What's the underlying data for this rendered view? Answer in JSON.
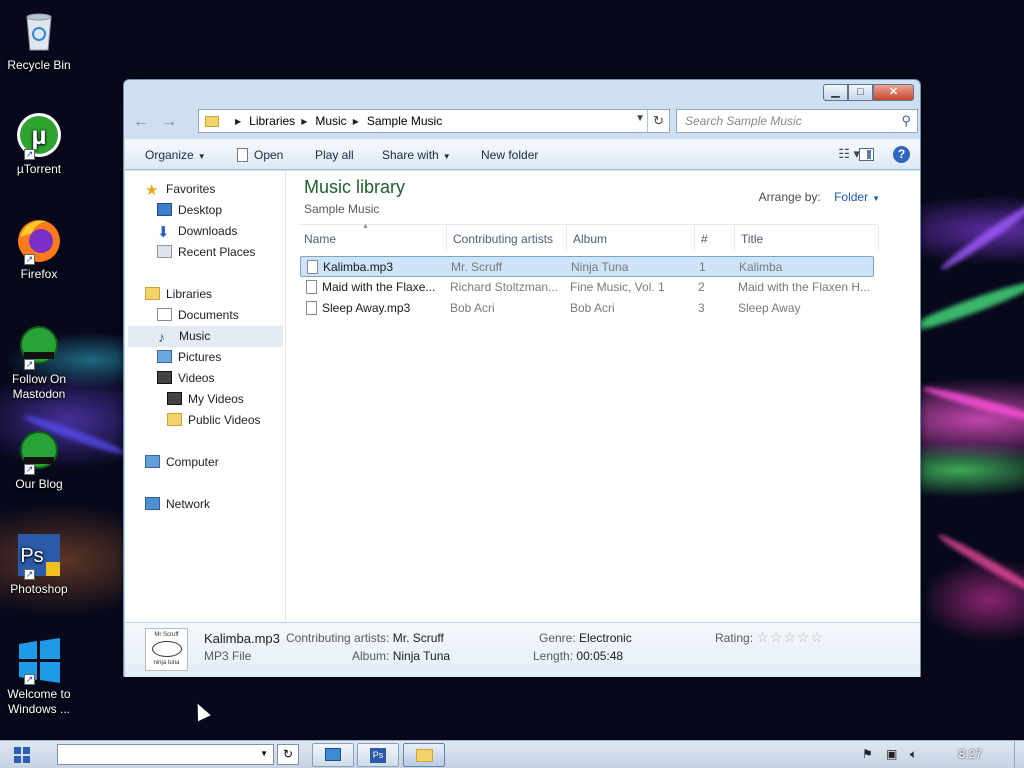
{
  "desktop": {
    "icons": [
      {
        "label": "Recycle Bin",
        "icon": "recycle-bin-icon"
      },
      {
        "label": "µTorrent",
        "icon": "utorrent-icon"
      },
      {
        "label": "Firefox",
        "icon": "firefox-icon"
      },
      {
        "label": "Follow On Mastodon",
        "icon": "mastodon-shortcut-icon"
      },
      {
        "label": "Our Blog",
        "icon": "blog-shortcut-icon"
      },
      {
        "label": "Photoshop",
        "icon": "photoshop-icon"
      },
      {
        "label": "Welcome to Windows ...",
        "icon": "windows-logo-icon"
      }
    ]
  },
  "window": {
    "address": {
      "crumbs": [
        "Libraries",
        "Music",
        "Sample Music"
      ]
    },
    "search": {
      "placeholder": "Search Sample Music"
    },
    "toolbar": {
      "organize": "Organize",
      "open": "Open",
      "play_all": "Play all",
      "share_with": "Share with",
      "new_folder": "New folder"
    },
    "nav": {
      "favorites": "Favorites",
      "desktop": "Desktop",
      "downloads": "Downloads",
      "recent_places": "Recent Places",
      "libraries": "Libraries",
      "documents": "Documents",
      "music": "Music",
      "pictures": "Pictures",
      "videos": "Videos",
      "my_videos": "My Videos",
      "public_videos": "Public Videos",
      "computer": "Computer",
      "network": "Network"
    },
    "library": {
      "title": "Music library",
      "subtitle": "Sample Music",
      "arrange_label": "Arrange by:",
      "arrange_value": "Folder"
    },
    "columns": {
      "name": "Name",
      "artists": "Contributing artists",
      "album": "Album",
      "number": "#",
      "title": "Title"
    },
    "files": [
      {
        "name": "Kalimba.mp3",
        "artist": "Mr. Scruff",
        "album": "Ninja Tuna",
        "number": "1",
        "title": "Kalimba"
      },
      {
        "name": "Maid with the Flaxe...",
        "artist": "Richard Stoltzman...",
        "album": "Fine Music, Vol. 1",
        "number": "2",
        "title": "Maid with the Flaxen H..."
      },
      {
        "name": "Sleep Away.mp3",
        "artist": "Bob Acri",
        "album": "Bob Acri",
        "number": "3",
        "title": "Sleep Away"
      }
    ],
    "details": {
      "art_text_top": "Mr Scruff",
      "art_text_bottom": "ninja tuna",
      "file_name": "Kalimba.mp3",
      "file_type": "MP3 File",
      "artists_label": "Contributing artists:",
      "artists_value": "Mr. Scruff",
      "album_label": "Album:",
      "album_value": "Ninja Tuna",
      "genre_label": "Genre:",
      "genre_value": "Electronic",
      "length_label": "Length:",
      "length_value": "00:05:48",
      "rating_label": "Rating:",
      "rating_stars": "☆☆☆☆☆"
    }
  },
  "taskbar": {
    "clock": "8:27"
  },
  "colors": {
    "accent": "#2a5db8",
    "library_title": "#1e5f2a",
    "selection": "#cde3f8"
  }
}
